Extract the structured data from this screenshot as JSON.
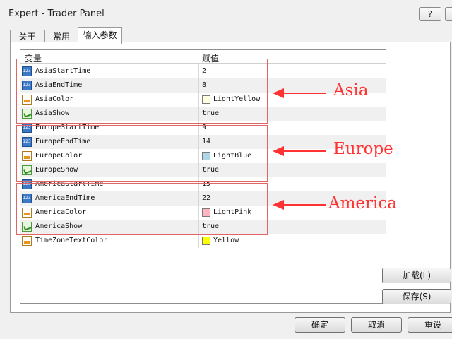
{
  "window": {
    "title": "Expert - Trader Panel",
    "help_label": "?",
    "close_label": "✕"
  },
  "tabs": [
    {
      "label": "关于"
    },
    {
      "label": "常用"
    },
    {
      "label": "输入参数"
    }
  ],
  "grid": {
    "col_variable": "变量",
    "col_value": "赋值",
    "rows": [
      {
        "icon": "number-icon",
        "name": "AsiaStartTime",
        "value": "2"
      },
      {
        "icon": "number-icon",
        "name": "AsiaEndTime",
        "value": "8"
      },
      {
        "icon": "color-icon",
        "name": "AsiaColor",
        "value": "LightYellow",
        "swatch": "#ffffe0"
      },
      {
        "icon": "boolean-icon",
        "name": "AsiaShow",
        "value": "true"
      },
      {
        "icon": "number-icon",
        "name": "EuropeStartTime",
        "value": "9"
      },
      {
        "icon": "number-icon",
        "name": "EuropeEndTime",
        "value": "14"
      },
      {
        "icon": "color-icon",
        "name": "EuropeColor",
        "value": "LightBlue",
        "swatch": "#add8e6"
      },
      {
        "icon": "boolean-icon",
        "name": "EuropeShow",
        "value": "true"
      },
      {
        "icon": "number-icon",
        "name": "AmericaStartTime",
        "value": "15"
      },
      {
        "icon": "number-icon",
        "name": "AmericaEndTime",
        "value": "22"
      },
      {
        "icon": "color-icon",
        "name": "AmericaColor",
        "value": "LightPink",
        "swatch": "#ffb6c1"
      },
      {
        "icon": "boolean-icon",
        "name": "AmericaShow",
        "value": "true"
      },
      {
        "icon": "color-icon",
        "name": "TimeZoneTextColor",
        "value": "Yellow",
        "swatch": "#ffff00"
      }
    ]
  },
  "icon_labels": {
    "number": "123"
  },
  "annotations": {
    "asia": "Asia",
    "europe": "Europe",
    "america": "America",
    "color": "#ff3333"
  },
  "side_buttons": {
    "load": "加载(L)",
    "save": "保存(S)"
  },
  "footer_buttons": {
    "ok": "确定",
    "cancel": "取消",
    "reset": "重设"
  }
}
